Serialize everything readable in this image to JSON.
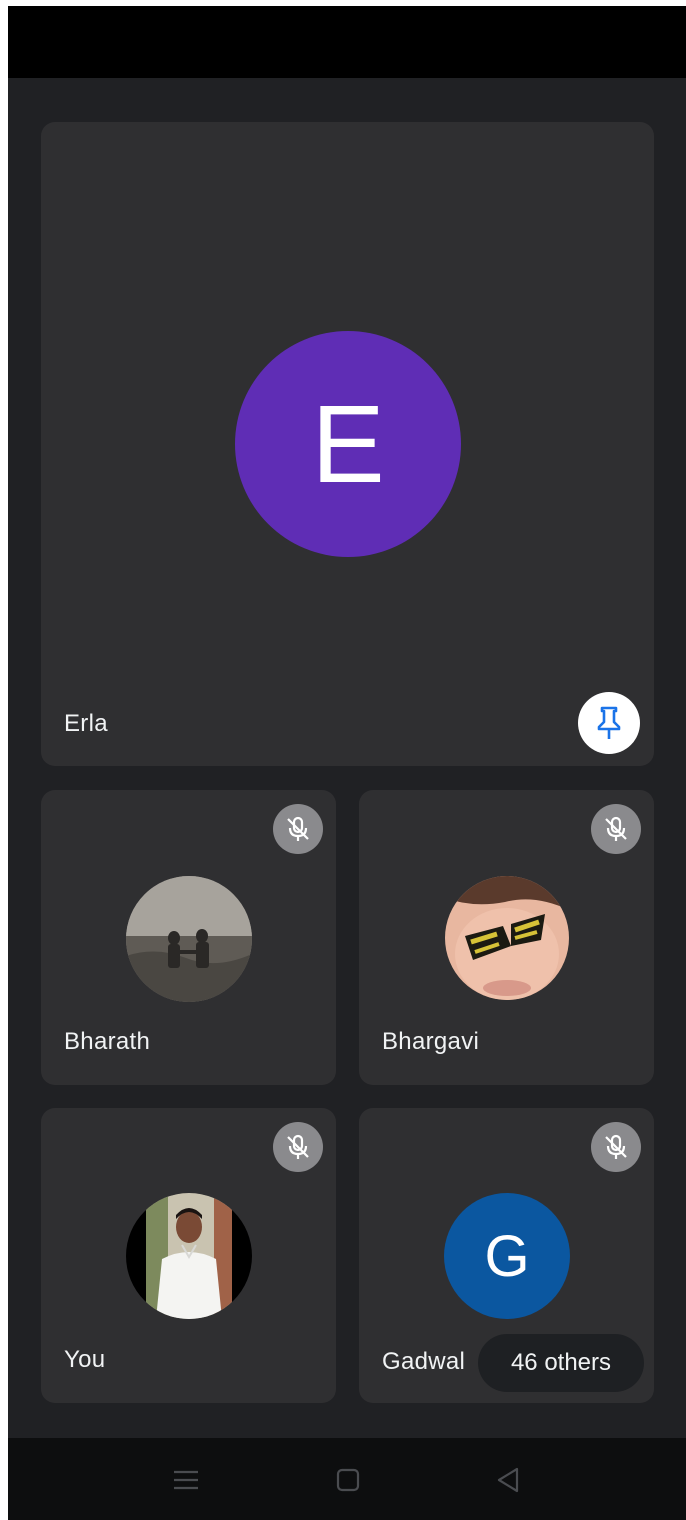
{
  "main_tile": {
    "name": "Erla",
    "avatar_letter": "E",
    "avatar_color": "#5f2db5"
  },
  "tiles": [
    {
      "name": "Bharath"
    },
    {
      "name": "Bhargavi"
    },
    {
      "name": "You"
    },
    {
      "name": "Gadwal",
      "avatar_letter": "G",
      "avatar_color": "#0b57a0"
    }
  ],
  "others_chip": {
    "label": "46 others"
  },
  "icons": {
    "pin": "pin-icon",
    "mute": "mic-off-icon",
    "nav": [
      "menu-icon",
      "home-icon",
      "back-icon"
    ]
  },
  "colors": {
    "accent": "#1a73e8"
  }
}
